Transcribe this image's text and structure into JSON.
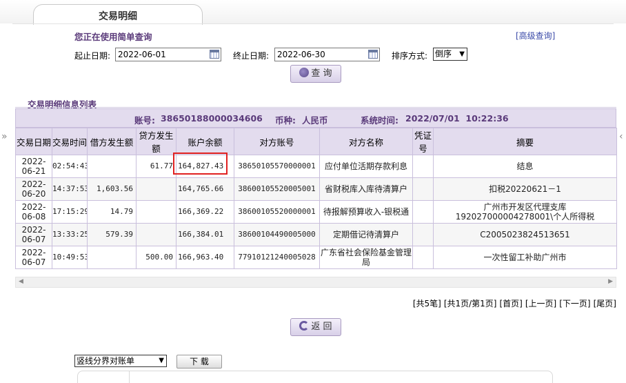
{
  "tab": {
    "title": "交易明细"
  },
  "query": {
    "title": "您正在使用简单查询",
    "advanced_link": "[高级查询]",
    "start_label": "起止日期:",
    "start_value": "2022-06-01",
    "end_label": "终止日期:",
    "end_value": "2022-06-30",
    "sort_label": "排序方式:",
    "sort_value": "倒序",
    "search_button": "查 询"
  },
  "list": {
    "title": "交易明细信息列表",
    "account_label": "账号:",
    "account_value": "38650188000034606",
    "currency_label": "币种:",
    "currency_value": "人民币",
    "systime_label": "系统时间:",
    "systime_value": "2022/07/01  10:22:36"
  },
  "table": {
    "headers": [
      "交易日期",
      "交易时间",
      "借方发生额",
      "贷方发生额",
      "账户余额",
      "对方账号",
      "对方名称",
      "凭证号",
      "摘要"
    ],
    "rows": [
      [
        "2022-06-21",
        "02:54:43",
        "",
        "61.77",
        "164,827.43",
        "38650105570000001",
        "应付单位活期存款利息",
        "",
        "结息"
      ],
      [
        "2022-06-20",
        "14:37:53",
        "1,603.56",
        "",
        "164,765.66",
        "38600105520005001",
        "省财税库入库待清算户",
        "",
        "扣税20220621－1"
      ],
      [
        "2022-06-08",
        "17:15:29",
        "14.79",
        "",
        "166,369.22",
        "38600105520000001",
        "待报解预算收入-银税通",
        "",
        "广州市开发区代理支库192027000004278001\\个人所得税"
      ],
      [
        "2022-06-07",
        "13:33:25",
        "579.39",
        "",
        "166,384.01",
        "38600104490005000",
        "定期借记待清算户",
        "",
        "C2005023824513651"
      ],
      [
        "2022-06-07",
        "10:49:53",
        "",
        "500.00",
        "166,963.40",
        "77910121240005028",
        "广东省社会保险基金管理局",
        "",
        "一次性留工补助广州市"
      ]
    ]
  },
  "pager": {
    "total": "[共5笔]",
    "pages": "[共1页/第1页]",
    "first": "[首页]",
    "prev": "[上一页]",
    "next": "[下一页]",
    "last": "[尾页]"
  },
  "return_button": "返 回",
  "export": {
    "select_value": "竖线分界对账单",
    "download_button": "下 载"
  },
  "colors": {
    "header_bg": "#e3dcee",
    "title_color": "#5a3a7a",
    "highlight": "#e02020"
  }
}
